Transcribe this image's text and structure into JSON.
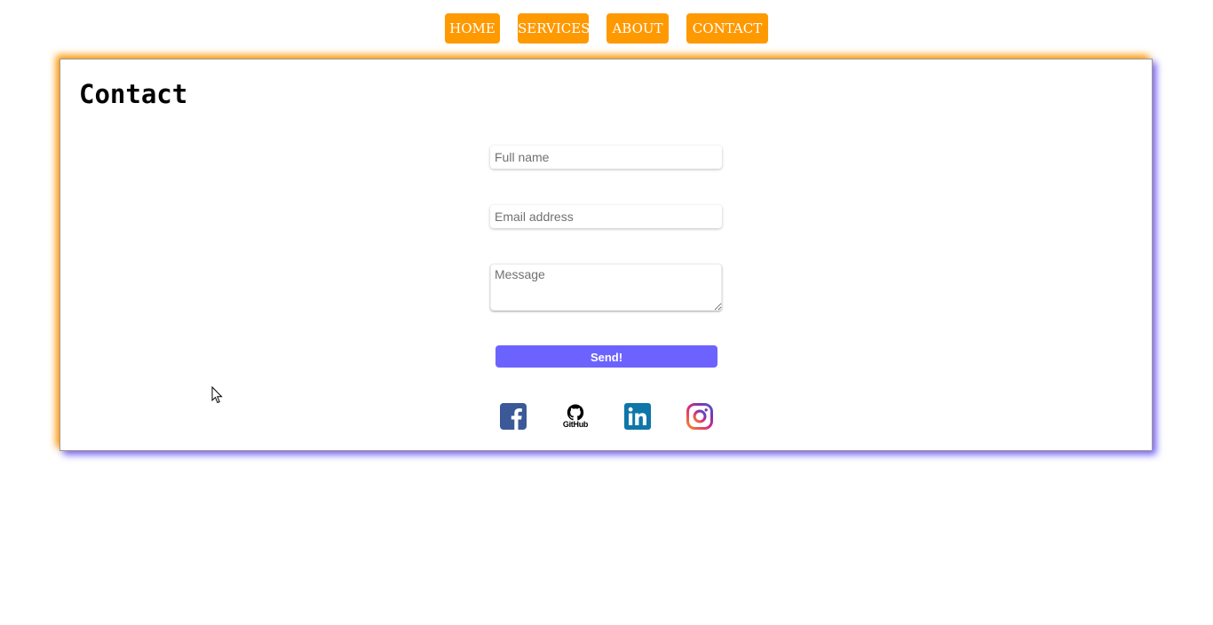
{
  "nav": {
    "items": [
      {
        "label": "HOME"
      },
      {
        "label": "SERVICES"
      },
      {
        "label": "ABOUT"
      },
      {
        "label": "CONTACT"
      }
    ],
    "color": "#ff9900"
  },
  "contact": {
    "title": "Contact",
    "form": {
      "full_name_placeholder": "Full name",
      "email_placeholder": "Email address",
      "message_placeholder": "Message",
      "full_name_value": "",
      "email_value": "",
      "message_value": "",
      "send_label": "Send!"
    },
    "accent_color": "#6c63ff",
    "social": [
      {
        "icon": "facebook-icon",
        "color": "#3b5998"
      },
      {
        "icon": "github-icon",
        "label": "GitHub",
        "color": "#000000"
      },
      {
        "icon": "linkedin-icon",
        "color": "#0e76a8"
      },
      {
        "icon": "instagram-icon",
        "color": "#c13584"
      }
    ]
  }
}
